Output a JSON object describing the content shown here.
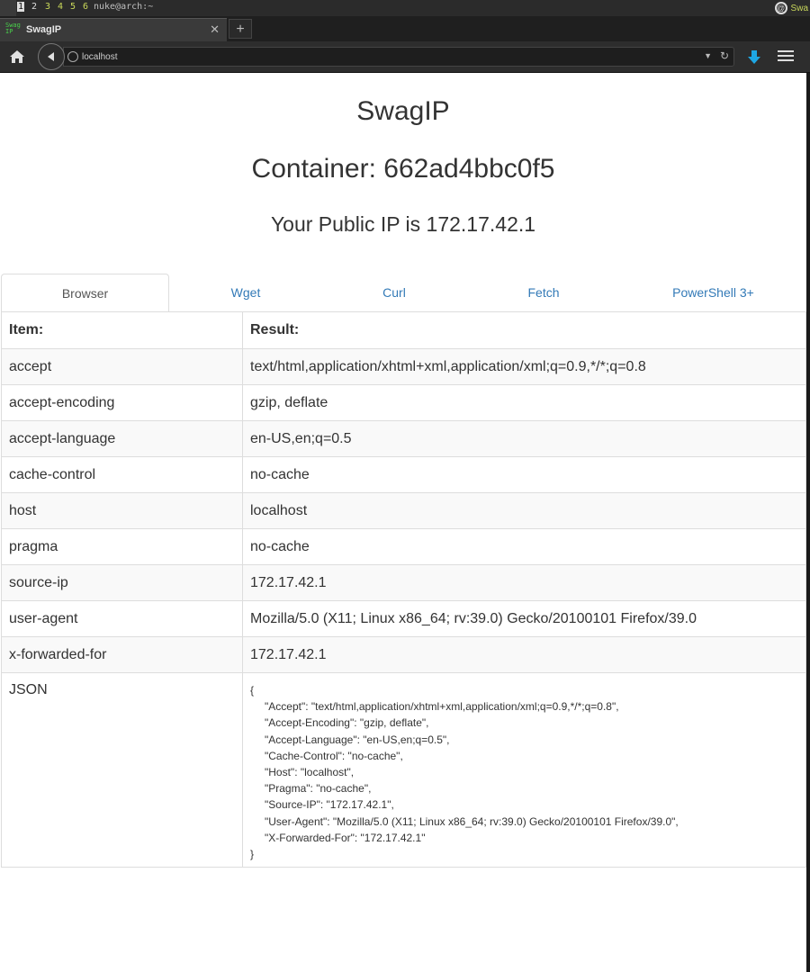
{
  "wm": {
    "workspaces": [
      "1",
      "2",
      "3",
      "4",
      "5",
      "6"
    ],
    "window_title": "nuke@arch:~",
    "right_text": "Swa"
  },
  "browser": {
    "tab_title": "SwagIP",
    "tab_close": "✕",
    "new_tab": "+",
    "url": "localhost"
  },
  "page": {
    "title": "SwagIP",
    "container": "Container: 662ad4bbc0f5",
    "public_ip": "Your Public IP is 172.17.42.1",
    "tabs": [
      "Browser",
      "Wget",
      "Curl",
      "Fetch",
      "PowerShell 3+"
    ],
    "table": {
      "headers": [
        "Item:",
        "Result:"
      ],
      "rows": [
        {
          "item": "accept",
          "result": "text/html,application/xhtml+xml,application/xml;q=0.9,*/*;q=0.8"
        },
        {
          "item": "accept-encoding",
          "result": "gzip, deflate"
        },
        {
          "item": "accept-language",
          "result": "en-US,en;q=0.5"
        },
        {
          "item": "cache-control",
          "result": "no-cache"
        },
        {
          "item": "host",
          "result": "localhost"
        },
        {
          "item": "pragma",
          "result": "no-cache"
        },
        {
          "item": "source-ip",
          "result": "172.17.42.1"
        },
        {
          "item": "user-agent",
          "result": "Mozilla/5.0 (X11; Linux x86_64; rv:39.0) Gecko/20100101 Firefox/39.0"
        },
        {
          "item": "x-forwarded-for",
          "result": "172.17.42.1"
        }
      ],
      "json_label": "JSON",
      "json_lines": [
        "{",
        "\"Accept\": \"text/html,application/xhtml+xml,application/xml;q=0.9,*/*;q=0.8\",",
        "\"Accept-Encoding\": \"gzip, deflate\",",
        "\"Accept-Language\": \"en-US,en;q=0.5\",",
        "\"Cache-Control\": \"no-cache\",",
        "\"Host\": \"localhost\",",
        "\"Pragma\": \"no-cache\",",
        "\"Source-IP\": \"172.17.42.1\",",
        "\"User-Agent\": \"Mozilla/5.0 (X11; Linux x86_64; rv:39.0) Gecko/20100101 Firefox/39.0\",",
        "\"X-Forwarded-For\": \"172.17.42.1\"",
        "}"
      ]
    }
  },
  "colors": {
    "link": "#337ab7",
    "text": "#333333",
    "download_icon": "#1ea7e4",
    "favicon_green": "#49d14b"
  },
  "icons": {
    "home": "home-icon",
    "back": "back-arrow-icon",
    "reload": "reload-icon",
    "download": "download-icon",
    "menu": "hamburger-menu-icon"
  }
}
